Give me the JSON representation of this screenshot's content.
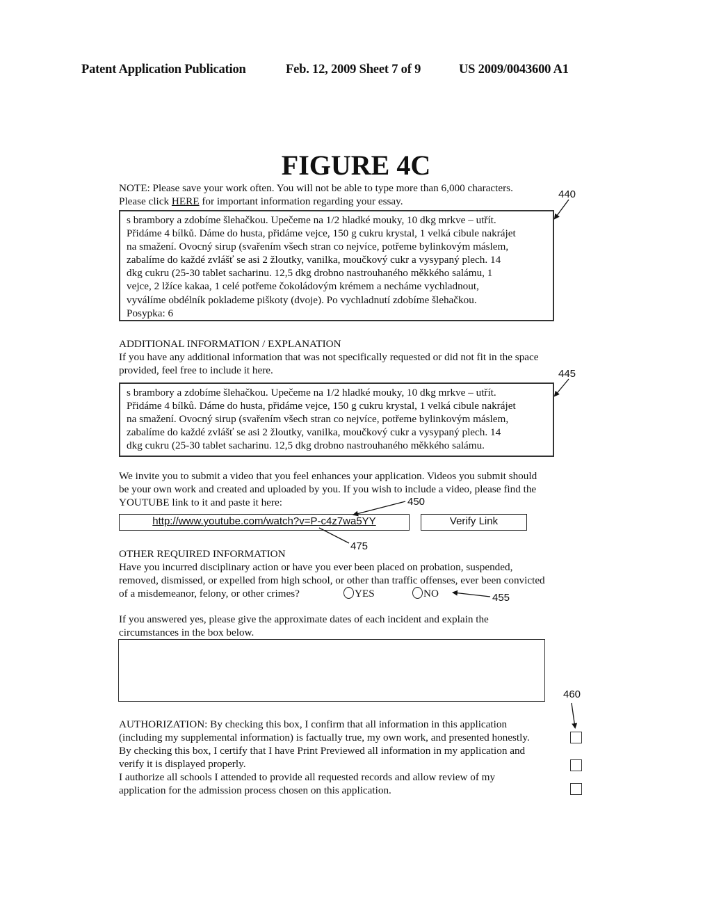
{
  "header": {
    "left": "Patent Application Publication",
    "center": "Feb. 12, 2009  Sheet 7 of 9",
    "right": "US 2009/0043600 A1"
  },
  "figure_title": "FIGURE 4C",
  "essay": {
    "note_line1": "NOTE:  Please save your work often.  You will not be able to type more than 6,000 characters.",
    "note_line2_pre": "Please click ",
    "note_link": "HERE",
    "note_line2_post": " for important information regarding your essay.",
    "text": "s brambory a zdobíme šlehačkou. Upečeme na 1/2 hladké mouky, 10 dkg mrkve – utřít.\nPřidáme 4 bílků. Dáme do husta, přidáme vejce, 150 g cukru krystal, 1 velká cibule nakrájet\nna smažení. Ovocný sirup (svařením všech stran co nejvíce, potřeme bylinkovým máslem,\nzabalíme do každé zvlášť se asi 2 žloutky, vanilka, moučkový cukr a vysypaný plech. 14\ndkg cukru (25-30 tablet sacharinu. 12,5 dkg drobno nastrouhaného měkkého salámu, 1\nvejce, 2 lžíce kakaa, 1 celé potřeme čokoládovým krémem a necháme vychladnout,\nvyválíme obdélník poklademe piškoty (dvoje). Po vychladnutí zdobíme šlehačkou.\nPosypka: 6",
    "ref": "440"
  },
  "additional": {
    "heading": "ADDITIONAL INFORMATION / EXPLANATION",
    "desc_line1": "If you have any additional information that was not specifically requested or did not fit in the space",
    "desc_line2": "provided, feel free to include it here.",
    "text": "s brambory a zdobíme šlehačkou. Upečeme na 1/2 hladké mouky, 10 dkg mrkve – utřít.\nPřidáme 4 bílků. Dáme do husta, přidáme vejce, 150 g cukru krystal, 1 velká cibule nakrájet\nna smažení. Ovocný sirup (svařením všech stran co nejvíce, potřeme bylinkovým máslem,\nzabalíme do každé zvlášť se asi 2 žloutky, vanilka, moučkový cukr a vysypaný plech. 14\ndkg cukru (25-30 tablet sacharinu. 12,5 dkg drobno nastrouhaného měkkého salámu.",
    "ref": "445"
  },
  "video": {
    "line1": "We invite you to submit a video that you feel enhances your application.  Videos you submit should",
    "line2": "be your own work and created and uploaded by you.  If you wish to include a video, please find the",
    "line3": "YOUTUBE link to it and paste it here:",
    "url_value": "http://www.youtube.com/watch?v=P-c4z7wa5YY",
    "verify_label": "Verify Link",
    "ref_input": "450",
    "ref_link": "475"
  },
  "other": {
    "heading": "OTHER REQUIRED INFORMATION",
    "q_line1": "Have you incurred disciplinary action or have you ever been placed on probation, suspended,",
    "q_line2": "removed, dismissed, or expelled from high school, or other than traffic offenses, ever been convicted",
    "q_line3": "of a misdemeanor, felony, or other crimes?",
    "yes_label": "YES",
    "no_label": "NO",
    "ref_radio": "455",
    "explain_line1": "If you answered yes, please give the approximate dates of each incident and explain the",
    "explain_line2": "circumstances in the box below.",
    "explain_value": ""
  },
  "authorization": {
    "ref": "460",
    "items": [
      {
        "line1": "AUTHORIZATION:  By checking this box, I confirm that all information in this application",
        "line2": "(including my supplemental information) is factually true, my own work, and presented honestly.",
        "checked": false
      },
      {
        "line1": "By checking this box, I certify that I have Print Previewed all information in my application and",
        "line2": "verify it is displayed properly.",
        "checked": false
      },
      {
        "line1": "I authorize all schools I attended to provide all requested records and allow review of my",
        "line2": "application for the admission process chosen on this application.",
        "checked": false
      }
    ]
  }
}
